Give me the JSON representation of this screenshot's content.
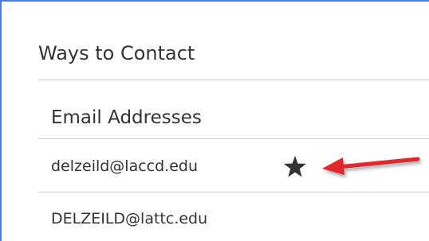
{
  "contact": {
    "section_title": "Ways to Contact",
    "email_heading": "Email Addresses",
    "emails": [
      {
        "address": "delzeild@laccd.edu",
        "preferred": true,
        "preferred_icon": "star-icon"
      },
      {
        "address": "DELZEILD@lattc.edu",
        "preferred": false
      }
    ]
  },
  "colors": {
    "frame_border": "#4a7fd4",
    "divider": "#cfcfcf",
    "text": "#333333",
    "star": "#333333",
    "annotation_arrow": "#e3272b"
  },
  "annotation": {
    "icon": "red-arrow-icon",
    "points_to": "star-icon"
  }
}
